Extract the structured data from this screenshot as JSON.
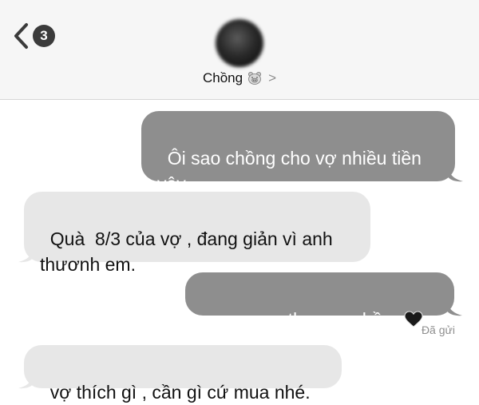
{
  "header": {
    "back_badge_count": "3",
    "contact_name": "Chồng",
    "contact_emoji": "pig-face-icon",
    "contact_chevron": ">"
  },
  "messages": [
    {
      "direction": "sent",
      "text": "Ôi sao chồng cho vợ nhiều tiền vậy."
    },
    {
      "direction": "received",
      "text": "Quà  8/3 của vợ , đang giản vì anh thươnh em."
    },
    {
      "direction": "sent",
      "text": "emmmm thương chồng",
      "trailing_emoji": "black-heart-icon"
    },
    {
      "direction": "received",
      "text": "vợ thích gì , cần gì cứ mua nhé."
    }
  ],
  "status": {
    "delivered_label": "Đã gửi"
  },
  "colors": {
    "sent_bubble": "#8e8e8e",
    "received_bubble": "#e7e7e7",
    "header_bg": "#f6f6f6"
  }
}
